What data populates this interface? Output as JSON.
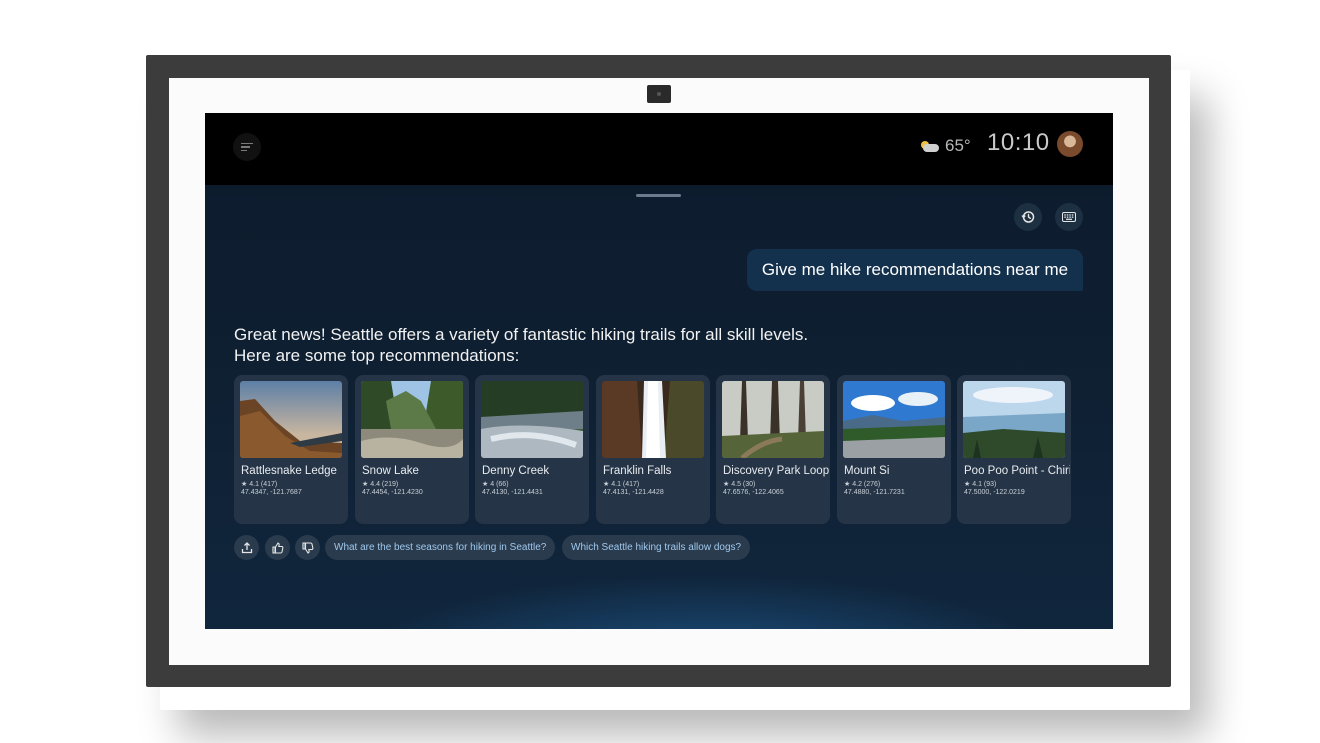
{
  "header": {
    "temperature": "65°",
    "time": "10:10",
    "weather_icon": "partly-cloudy-icon",
    "menu_icon": "menu-icon",
    "profile_icon": "avatar"
  },
  "toolbar": {
    "history_icon": "history-icon",
    "keyboard_icon": "keyboard-icon"
  },
  "conversation": {
    "user_message": "Give me hike recommendations near me",
    "assistant_reply": "Great news! Seattle offers a variety of fantastic hiking trails for all skill levels. Here are some top recommendations:"
  },
  "trails": [
    {
      "name": "Rattlesnake Ledge",
      "rating": "4.1 (417)",
      "coords": "47.4347, -121.7687"
    },
    {
      "name": "Snow Lake",
      "rating": "4.4 (219)",
      "coords": "47.4454, -121.4230"
    },
    {
      "name": "Denny Creek",
      "rating": "4 (66)",
      "coords": "47.4130, -121.4431"
    },
    {
      "name": "Franklin Falls",
      "rating": "4.1 (417)",
      "coords": "47.4131, -121.4428"
    },
    {
      "name": "Discovery Park Loop",
      "rating": "4.5 (30)",
      "coords": "47.6576, -122.4065"
    },
    {
      "name": "Mount Si",
      "rating": "4.2 (276)",
      "coords": "47.4880, -121.7231"
    },
    {
      "name": "Poo Poo Point - Chirico Trail",
      "rating": "4.1 (93)",
      "coords": "47.5000, -122.0219"
    }
  ],
  "actions": {
    "share_icon": "share-icon",
    "like_icon": "thumbs-up-icon",
    "dislike_icon": "thumbs-down-icon"
  },
  "suggestions": [
    "What are the best seasons for hiking in Seattle?",
    "Which Seattle hiking trails allow dogs?"
  ],
  "colors": {
    "screen_bg": "#0f2033",
    "user_bubble": "#13314d",
    "card_bg": "#253446",
    "chip_text": "#9fc8ec"
  }
}
